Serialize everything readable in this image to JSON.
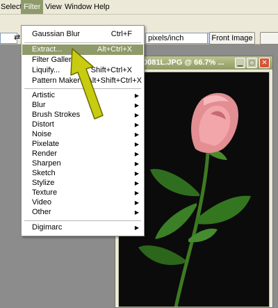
{
  "menubar": {
    "items": [
      "Select",
      "Filter",
      "View",
      "Window",
      "Help"
    ]
  },
  "options": {
    "resolution_unit": "pixels/inch",
    "front_image_label": "Front Image"
  },
  "document": {
    "title": "0081L.JPG @ 66.7% ...",
    "minimize_glyph": "▁",
    "maximize_glyph": "▢",
    "close_glyph": "✕"
  },
  "filter_menu": {
    "items": [
      {
        "label": "Gaussian Blur",
        "shortcut": "Ctrl+F"
      },
      {
        "label": "Extract...",
        "shortcut": "Alt+Ctrl+X"
      },
      {
        "label": "Filter Galler",
        "shortcut": ""
      },
      {
        "label": "Liquify...",
        "shortcut": "Shift+Ctrl+X"
      },
      {
        "label": "Pattern Maker",
        "shortcut": "Alt+Shift+Ctrl+X"
      },
      {
        "label": "Artistic",
        "shortcut": ""
      },
      {
        "label": "Blur",
        "shortcut": ""
      },
      {
        "label": "Brush Strokes",
        "shortcut": ""
      },
      {
        "label": "Distort",
        "shortcut": ""
      },
      {
        "label": "Noise",
        "shortcut": ""
      },
      {
        "label": "Pixelate",
        "shortcut": ""
      },
      {
        "label": "Render",
        "shortcut": ""
      },
      {
        "label": "Sharpen",
        "shortcut": ""
      },
      {
        "label": "Sketch",
        "shortcut": ""
      },
      {
        "label": "Stylize",
        "shortcut": ""
      },
      {
        "label": "Texture",
        "shortcut": ""
      },
      {
        "label": "Video",
        "shortcut": ""
      },
      {
        "label": "Other",
        "shortcut": ""
      },
      {
        "label": "Digimarc",
        "shortcut": ""
      }
    ],
    "submenu_glyph": "▶"
  },
  "colors": {
    "menu_highlight": "#8f9a6a",
    "annotation_arrow": "#c8cc10"
  }
}
